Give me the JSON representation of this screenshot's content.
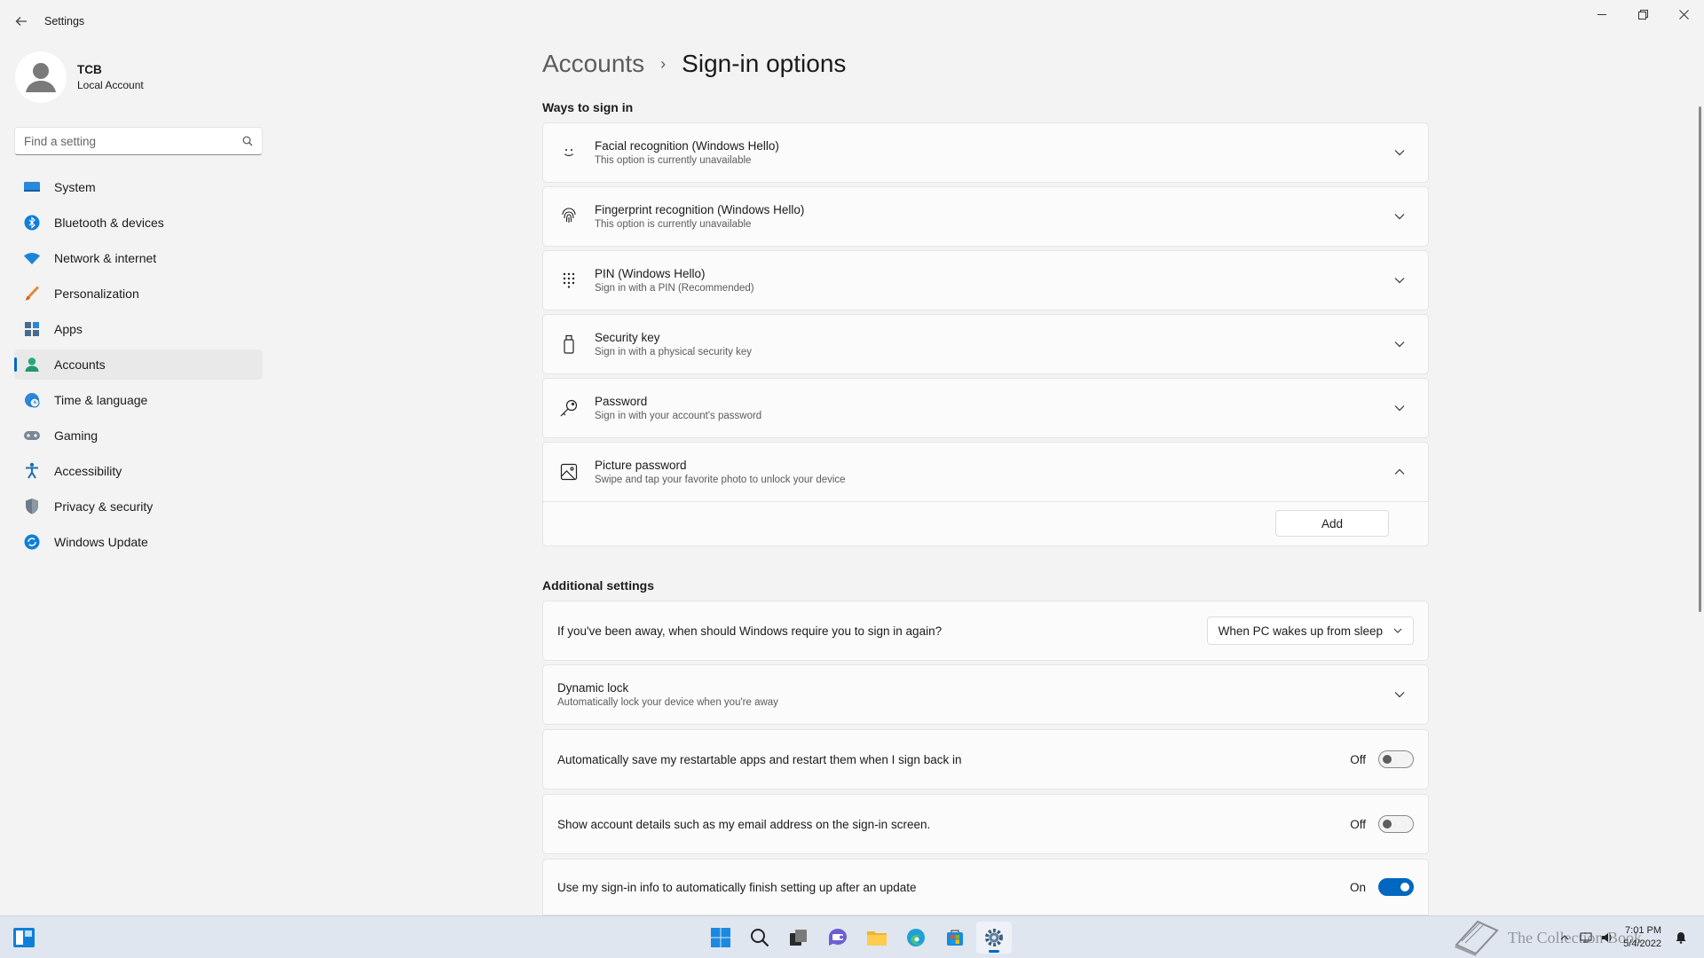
{
  "window": {
    "title": "Settings",
    "back_icon": "back-arrow-icon",
    "controls": [
      "minimize-icon",
      "restore-icon",
      "close-icon"
    ]
  },
  "profile": {
    "name": "TCB",
    "account_type": "Local Account"
  },
  "search": {
    "placeholder": "Find a setting"
  },
  "sidebar": {
    "items": [
      {
        "label": "System",
        "icon": "system-icon"
      },
      {
        "label": "Bluetooth & devices",
        "icon": "bluetooth-icon"
      },
      {
        "label": "Network & internet",
        "icon": "wifi-icon"
      },
      {
        "label": "Personalization",
        "icon": "brush-icon"
      },
      {
        "label": "Apps",
        "icon": "apps-icon"
      },
      {
        "label": "Accounts",
        "icon": "accounts-icon",
        "active": true
      },
      {
        "label": "Time & language",
        "icon": "globe-clock-icon"
      },
      {
        "label": "Gaming",
        "icon": "gamepad-icon"
      },
      {
        "label": "Accessibility",
        "icon": "accessibility-icon"
      },
      {
        "label": "Privacy & security",
        "icon": "shield-icon"
      },
      {
        "label": "Windows Update",
        "icon": "update-icon"
      }
    ]
  },
  "breadcrumb": {
    "parent": "Accounts",
    "separator": "›",
    "current": "Sign-in options"
  },
  "ways_to_sign_in": {
    "heading": "Ways to sign in",
    "items": [
      {
        "title": "Facial recognition (Windows Hello)",
        "subtitle": "This option is currently unavailable",
        "icon": "face-icon",
        "expanded": false
      },
      {
        "title": "Fingerprint recognition (Windows Hello)",
        "subtitle": "This option is currently unavailable",
        "icon": "fingerprint-icon",
        "expanded": false
      },
      {
        "title": "PIN (Windows Hello)",
        "subtitle": "Sign in with a PIN (Recommended)",
        "icon": "keypad-icon",
        "expanded": false
      },
      {
        "title": "Security key",
        "subtitle": "Sign in with a physical security key",
        "icon": "usb-key-icon",
        "expanded": false
      },
      {
        "title": "Password",
        "subtitle": "Sign in with your account's password",
        "icon": "key-icon",
        "expanded": false
      },
      {
        "title": "Picture password",
        "subtitle": "Swipe and tap your favorite photo to unlock your device",
        "icon": "picture-icon",
        "expanded": true
      }
    ],
    "add_button": "Add"
  },
  "additional_settings": {
    "heading": "Additional settings",
    "require_signin": {
      "label": "If you've been away, when should Windows require you to sign in again?",
      "selected": "When PC wakes up from sleep"
    },
    "dynamic_lock": {
      "title": "Dynamic lock",
      "subtitle": "Automatically lock your device when you're away"
    },
    "toggles": [
      {
        "label": "Automatically save my restartable apps and restart them when I sign back in",
        "state_text": "Off",
        "on": false
      },
      {
        "label": "Show account details such as my email address on the sign-in screen.",
        "state_text": "Off",
        "on": false
      },
      {
        "label": "Use my sign-in info to automatically finish setting up after an update",
        "state_text": "On",
        "on": true
      }
    ]
  },
  "taskbar": {
    "apps": [
      "start-icon",
      "search-icon",
      "task-view-icon",
      "chat-icon",
      "file-explorer-icon",
      "edge-icon",
      "store-icon",
      "settings-icon"
    ],
    "active_app": "settings-icon",
    "time": "7:01 PM",
    "date": "5/4/2022",
    "watermark": "The Collection Book"
  },
  "colors": {
    "accent": "#0067c0",
    "background": "#f3f3f3",
    "card": "#fbfbfb"
  }
}
